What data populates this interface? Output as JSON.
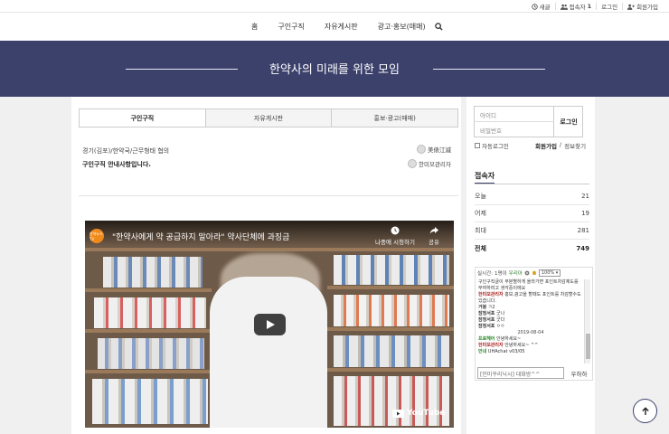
{
  "topbar": {
    "new_label": "새글",
    "visitors_label": "접속자",
    "visitors_count": "1",
    "login_label": "로그인",
    "join_label": "회원가입"
  },
  "nav": {
    "items": [
      "홈",
      "구인구직",
      "자유게시판",
      "광고·홍보(매매)"
    ]
  },
  "banner": {
    "title": "한약사의 미래를 위한 모임"
  },
  "tabs": [
    "구인구직",
    "자유게시판",
    "홍보·광고(매매)"
  ],
  "posts": [
    {
      "text": "경기(김포)/한약국/근무형태 협의",
      "author": "美俵江滅"
    },
    {
      "text": "구인구직 안내사항입니다.",
      "author": "한미모관리자"
    }
  ],
  "video": {
    "channel_logo": "한약뉴스TV",
    "title": "\"한약사에게 약 공급하지 말아라\" 약사단체에 과징금",
    "watch_later": "나중에 시청하기",
    "share": "공유",
    "youtube": "YouTube"
  },
  "login": {
    "id_placeholder": "아이디",
    "pw_placeholder": "비밀번호",
    "button": "로그인",
    "auto_login": "자동로그인",
    "join": "회원가입",
    "find": "정보찾기"
  },
  "visitors": {
    "title": "접속자",
    "rows": [
      {
        "label": "오늘",
        "value": "21"
      },
      {
        "label": "어제",
        "value": "19"
      },
      {
        "label": "최대",
        "value": "281"
      },
      {
        "label": "전체",
        "value": "749"
      }
    ]
  },
  "chat": {
    "realtime": "실시간:",
    "count": "1명이",
    "user": "우리아",
    "zoom": "100%",
    "line1": "구인구직글이 무분별하게 올라가면 포인트차감제도를 부여하려고 생각중이에요",
    "line2_name": "한미모관리자",
    "line2": "홍보,광고을 할때도 포인트를 차감할수도 있습니다.",
    "m1_name": "거붕",
    "m1": "ㅋ2",
    "m2_name": "잠정서포",
    "m2": "굿나",
    "m3_name": "잠정서포",
    "m3": "굿다",
    "m4_name": "잠정서포",
    "m4": "ㅇㅇ",
    "date": "2019-08-04",
    "m5_name": "프로헤어",
    "m5": "안녕하세요~",
    "m6_name": "한미모관리자",
    "m6": "안녕하세요~ ^^",
    "m7_name": "안내",
    "m7": "UHAchat v03/05",
    "input_placeholder": "[인미꾸리닉시] 대화방^^",
    "send": "우하하"
  }
}
